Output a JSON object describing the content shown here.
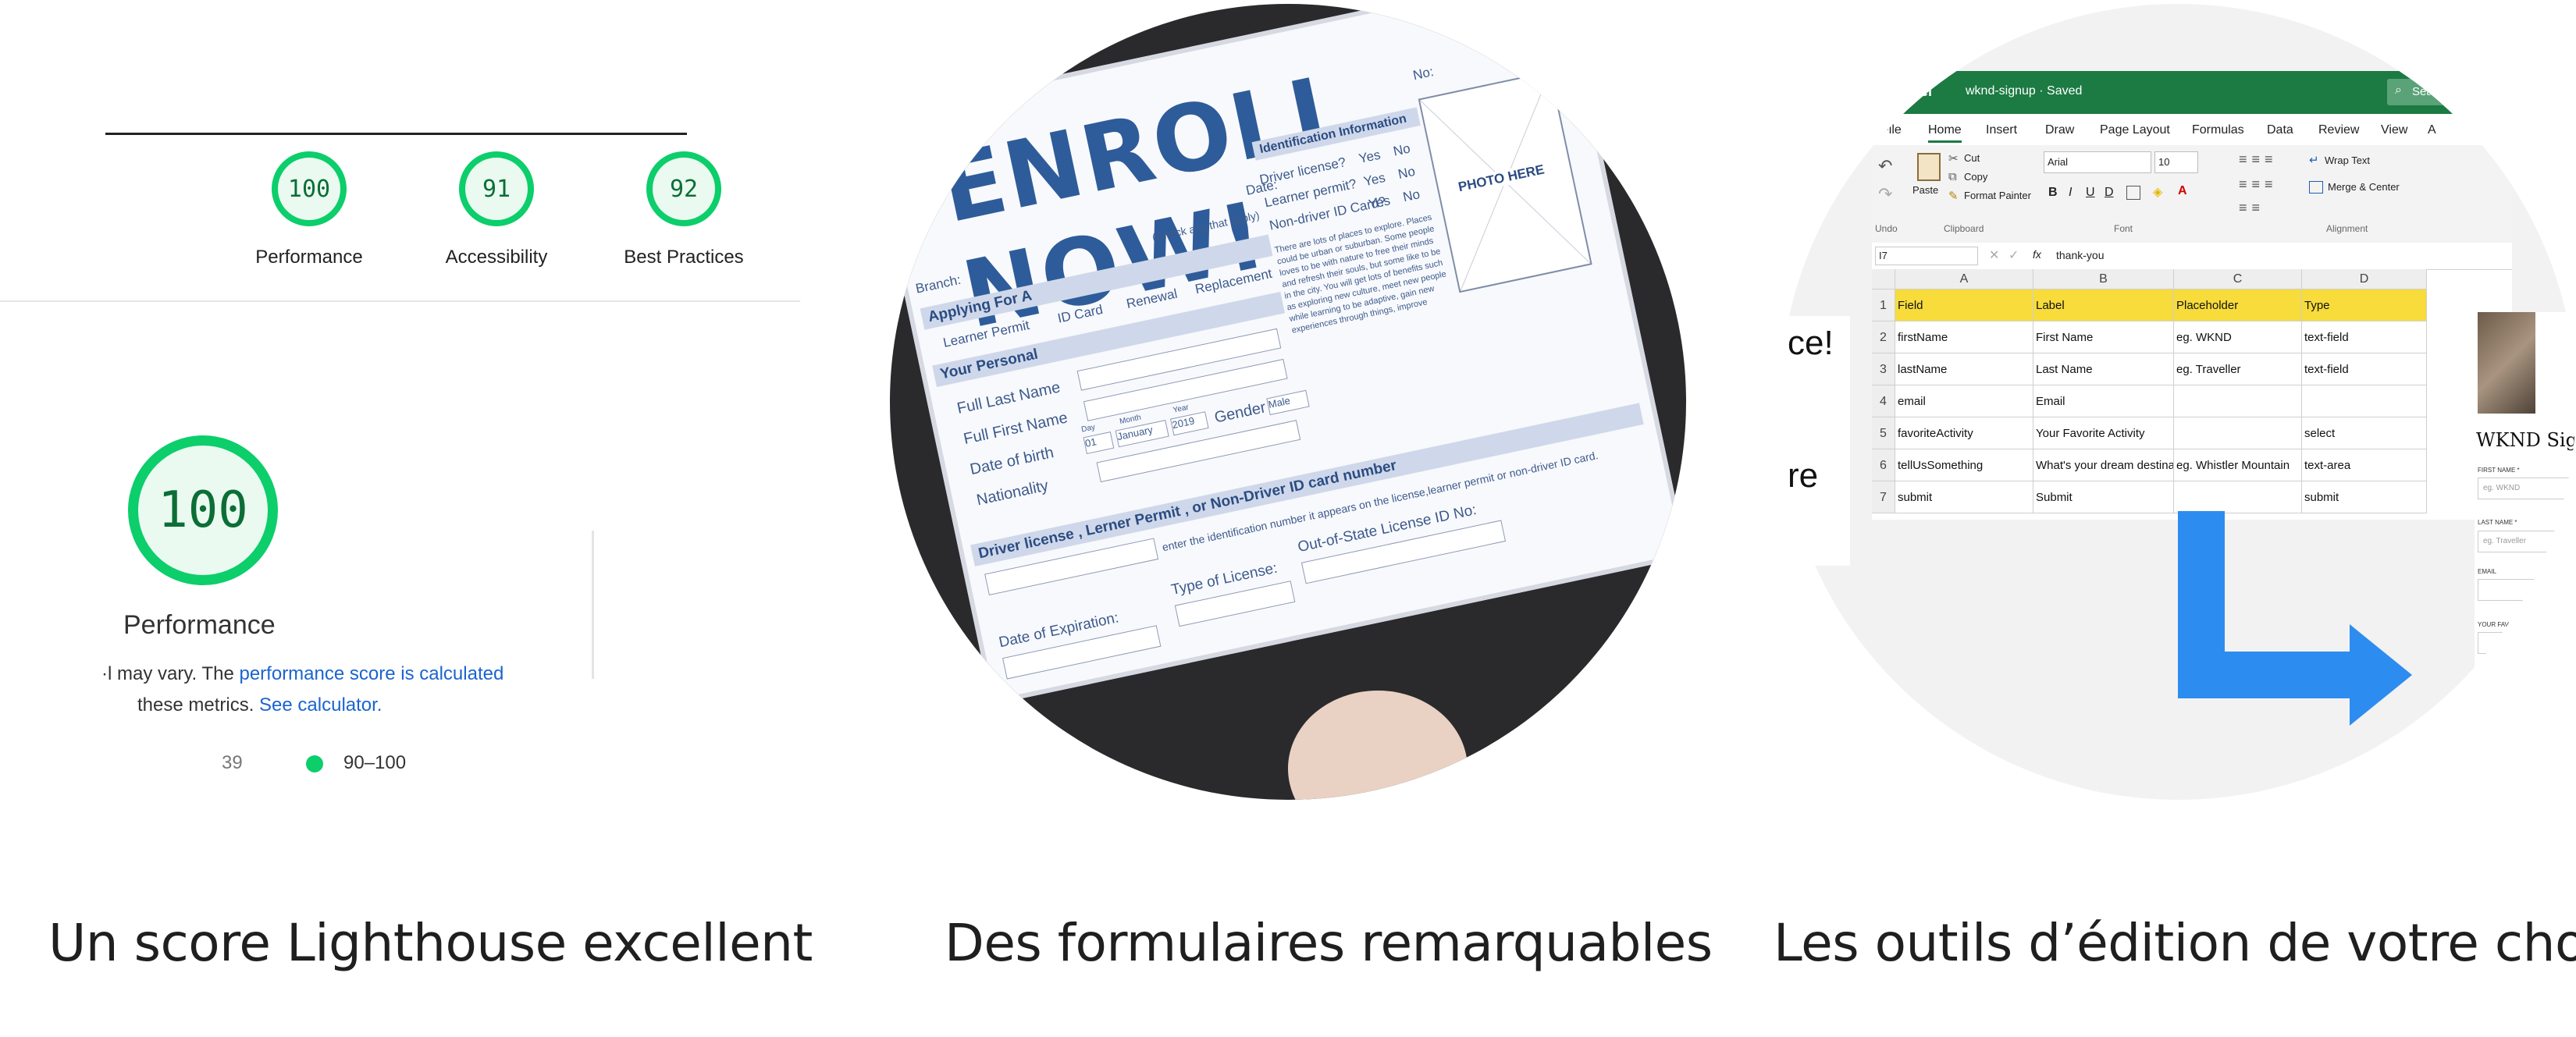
{
  "captions": {
    "lighthouse": "Un score Lighthouse excellent",
    "forms": "Des formulaires remarquables",
    "tools": "Les outils d’édition de votre choix"
  },
  "lighthouse": {
    "scores": [
      {
        "value": "100",
        "label": "Performance"
      },
      {
        "value": "91",
        "label": "Accessibility"
      },
      {
        "value": "92",
        "label": "Best Practices"
      }
    ],
    "main_score": "100",
    "main_label": "Performance",
    "line1_prefix": "·l may vary. The ",
    "line1_link": "performance score is calculated",
    "line2_prefix": "these metrics. ",
    "line2_link": "See calculator.",
    "legend_partial": "39",
    "legend_range": "90–100",
    "colors": {
      "good": "#0cce6b",
      "text": "#0c6e36",
      "link": "#1a64d0"
    }
  },
  "enroll_form": {
    "title": "ENROLL NOW!",
    "no_label": "No:",
    "date_label": "Date:",
    "branch_label": "Branch:",
    "check_hint": "(Check any that apply)",
    "applying_for": "Applying For A",
    "id_card": "ID Card",
    "renewal": "Renewal",
    "replacement": "Replacement",
    "learner_permit": "Learner Permit",
    "your_personal": "Your Personal",
    "full_last_name": "Full Last Name",
    "full_first_name": "Full First Name",
    "date_of_birth": "Date of birth",
    "dob_day": "01",
    "dob_month": "January",
    "dob_year": "2019",
    "day_hint": "Day",
    "month_hint": "Month",
    "year_hint": "Year",
    "gender_label": "Gender",
    "gender_value": "Male",
    "nationality": "Nationality",
    "identification": "Identification Information",
    "driver_license_q": "Driver license?",
    "learner_permit_q": "Learner permit?",
    "non_driver_q": "Non-driver ID Card?",
    "yes": "Yes",
    "no": "No",
    "photo_here": "PHOTO HERE",
    "blurb": "There are lots of places to explore. Places could be urban or suburban. Some people loves to be with nature to free their minds and refresh their souls, but some like to be in the city. You will get lots of benefits such as exploring new culture, meet new people while learning to be adaptive, gain new experiences through things, improve",
    "license_section": "Driver license , Lerner Permit , or Non-Driver ID card number",
    "license_hint": "enter the identification number it appears on the license,learner permit or non-driver ID card.",
    "out_of_state": "Out-of-State License ID No:",
    "type_of_license": "Type of License:",
    "date_of_expiration": "Date of Expiration:",
    "colors": {
      "title": "#2e5c9a",
      "section": "#cfd8ea"
    }
  },
  "excel": {
    "app": "Excel",
    "file": "wknd-signup · Saved",
    "search": "Search",
    "menu": [
      "File",
      "Home",
      "Insert",
      "Draw",
      "Page Layout",
      "Formulas",
      "Data",
      "Review",
      "View",
      "A"
    ],
    "ribbon": {
      "undo": "Undo",
      "paste": "Paste",
      "cut": "Cut",
      "copy": "Copy",
      "format_painter": "Format Painter",
      "clipboard": "Clipboard",
      "font_name": "Arial",
      "font_size": "10",
      "font": "Font",
      "wrap_text": "Wrap Text",
      "merge_center": "Merge & Center",
      "alignment": "Alignment"
    },
    "name_box": "I7",
    "formula": "thank-you",
    "fx": "fx",
    "columns": [
      "A",
      "B",
      "C",
      "D"
    ],
    "rows": [
      {
        "n": "1",
        "cells": [
          "Field",
          "Label",
          "Placeholder",
          "Type"
        ]
      },
      {
        "n": "2",
        "cells": [
          "firstName",
          "First Name",
          "eg. WKND",
          "text-field"
        ]
      },
      {
        "n": "3",
        "cells": [
          "lastName",
          "Last Name",
          "eg. Traveller",
          "text-field"
        ]
      },
      {
        "n": "4",
        "cells": [
          "email",
          "Email",
          "",
          ""
        ]
      },
      {
        "n": "5",
        "cells": [
          "favoriteActivity",
          "Your Favorite Activity",
          "",
          "select"
        ]
      },
      {
        "n": "6",
        "cells": [
          "tellUsSomething",
          "What's your dream destinati",
          "eg. Whistler Mountain",
          "text-area"
        ]
      },
      {
        "n": "7",
        "cells": [
          "submit",
          "Submit",
          "",
          "submit"
        ]
      }
    ],
    "left_fragments": [
      "ce!",
      "re"
    ],
    "header_color": "#f7dc3b",
    "green": "#1c7a43",
    "arrow_color": "#2d8cf0",
    "wknd": {
      "title": "WKND Sign U",
      "first_name": "FIRST NAME *",
      "first_ph": "eg. WKND",
      "last_name": "LAST NAME *",
      "last_ph": "eg. Traveller",
      "email": "EMAIL",
      "favorite": "YOUR FAVORI"
    }
  }
}
